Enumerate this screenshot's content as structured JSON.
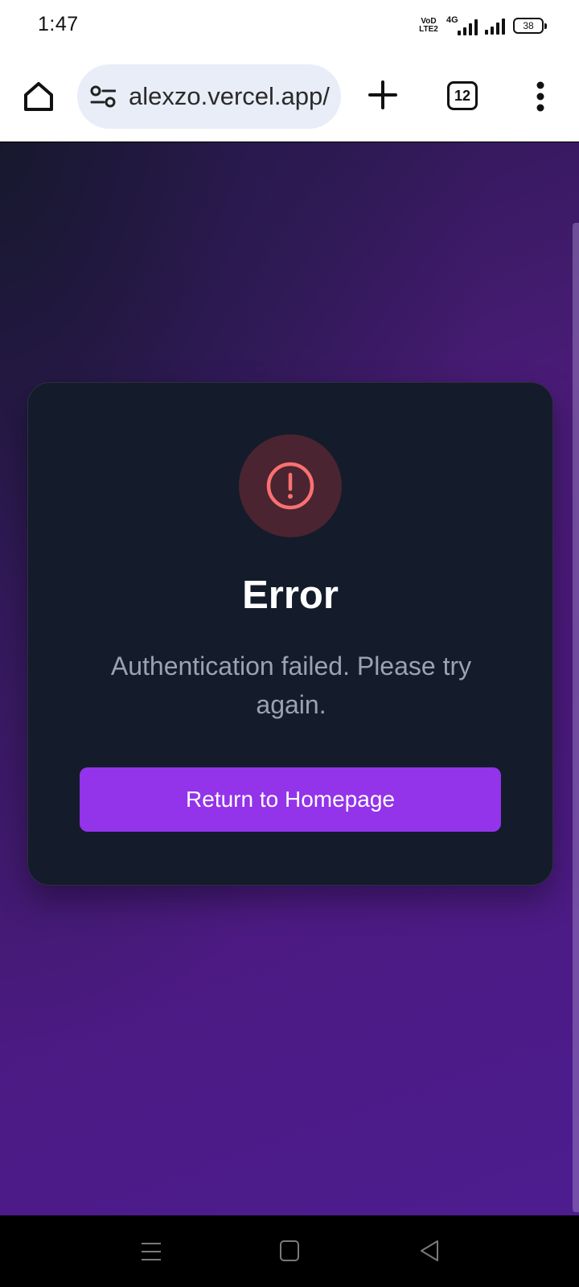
{
  "status_bar": {
    "time": "1:47",
    "volte": "VoD\nLTE2",
    "network": "4G",
    "battery": "38"
  },
  "browser": {
    "url": "alexzo.vercel.app/",
    "tab_count": "12"
  },
  "error_card": {
    "title": "Error",
    "message": "Authentication failed. Please try again.",
    "button_label": "Return to Homepage",
    "colors": {
      "accent": "#9333ea",
      "error_icon": "#f87171",
      "card_bg": "#141b2a"
    }
  },
  "icons": {
    "home": "home-icon",
    "site_info": "tune-icon",
    "new_tab": "plus-icon",
    "menu": "more-vert-icon",
    "error": "exclamation-circle-icon"
  }
}
